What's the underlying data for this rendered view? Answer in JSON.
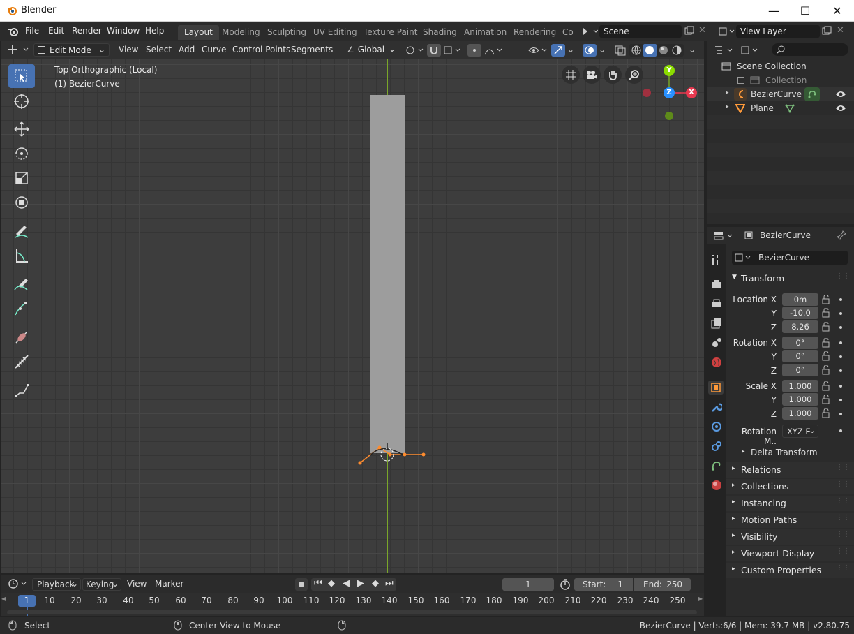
{
  "window": {
    "title": "Blender"
  },
  "menu": [
    "File",
    "Edit",
    "Render",
    "Window",
    "Help"
  ],
  "workspaces": [
    "Layout",
    "Modeling",
    "Sculpting",
    "UV Editing",
    "Texture Paint",
    "Shading",
    "Animation",
    "Rendering",
    "Co"
  ],
  "scene": {
    "name": "Scene",
    "view_layer": "View Layer"
  },
  "viewport_header": {
    "mode": "Edit Mode",
    "menus": [
      "View",
      "Select",
      "Add",
      "Curve",
      "Control Points",
      "Segments"
    ],
    "orientation": "Global"
  },
  "viewport": {
    "view_name": "Top Orthographic (Local)",
    "object_label": "(1) BezierCurve"
  },
  "gizmo": {
    "y": "Y",
    "z": "Z",
    "x": "X"
  },
  "outliner": {
    "scene_collection": "Scene Collection",
    "collection": "Collection",
    "objects": [
      "BezierCurve",
      "Plane"
    ]
  },
  "properties": {
    "object_name": "BezierCurve",
    "data_name": "BezierCurve",
    "transform_title": "Transform",
    "location": {
      "label": "Location X",
      "x": "0m",
      "y": "-10.0",
      "z": "8.26"
    },
    "rotation": {
      "label": "Rotation X",
      "x": "0°",
      "y": "0°",
      "z": "0°"
    },
    "scale": {
      "label": "Scale X",
      "x": "1.000",
      "y": "1.000",
      "z": "1.000"
    },
    "axis_y": "Y",
    "axis_z": "Z",
    "rotation_mode": {
      "label": "Rotation M..",
      "value": "XYZ E"
    },
    "delta": "Delta Transform",
    "sections": [
      "Relations",
      "Collections",
      "Instancing",
      "Motion Paths",
      "Visibility",
      "Viewport Display",
      "Custom Properties"
    ]
  },
  "timeline": {
    "menus": [
      "Playback",
      "Keying",
      "View",
      "Marker"
    ],
    "current_frame": "1",
    "start_label": "Start:",
    "start": "1",
    "end_label": "End:",
    "end": "250",
    "ticks": [
      "1",
      "10",
      "20",
      "30",
      "40",
      "50",
      "60",
      "70",
      "80",
      "90",
      "100",
      "110",
      "120",
      "130",
      "140",
      "150",
      "160",
      "170",
      "180",
      "190",
      "200",
      "210",
      "220",
      "230",
      "240",
      "250"
    ]
  },
  "status": {
    "left": "Select",
    "middle": "Center View to Mouse",
    "right": "BezierCurve | Verts:6/6 | Mem: 39.7 MB | v2.80.75"
  },
  "colors": {
    "accent": "#4772b3",
    "x_axis": "#e8384f",
    "y_axis": "#8bdc00",
    "z_axis": "#2890ff",
    "selected": "#ff8c2e"
  }
}
